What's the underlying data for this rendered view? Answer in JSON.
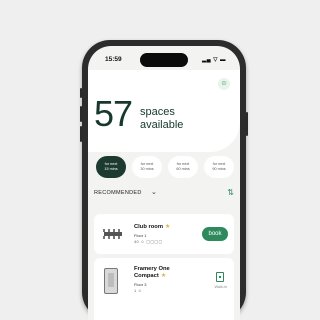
{
  "status_bar": {
    "time": "15:59",
    "signal": "▂▄ ▽ ▬"
  },
  "header": {
    "profile_icon": "person-icon"
  },
  "hero": {
    "count": "57",
    "line1": "spaces",
    "line2": "available"
  },
  "filters": [
    {
      "line1": "for next",
      "line2": "15 mins",
      "active": true
    },
    {
      "line1": "for next",
      "line2": "30 mins",
      "active": false
    },
    {
      "line1": "for next",
      "line2": "60 mins",
      "active": false
    },
    {
      "line1": "for next",
      "line2": "90 mins",
      "active": false
    }
  ],
  "recommended": {
    "label": "RECOMMENDED",
    "chevron": "⌄",
    "sort_icon": "⇅"
  },
  "cards": [
    {
      "name": "Club room",
      "star": "★",
      "floor": "Floor 1",
      "meta": "40 ☺ ▢▢▢▢",
      "action": "book"
    },
    {
      "name_line1": "Framery One",
      "name_line2": "Compact",
      "star": "★",
      "floor": "Floor 3",
      "meta": "1 ☺",
      "action": "Walk-in"
    }
  ],
  "colors": {
    "accent": "#2e8a5c",
    "dark": "#17382c",
    "chip_active": "#1d3a30",
    "star": "#e0b24c"
  }
}
